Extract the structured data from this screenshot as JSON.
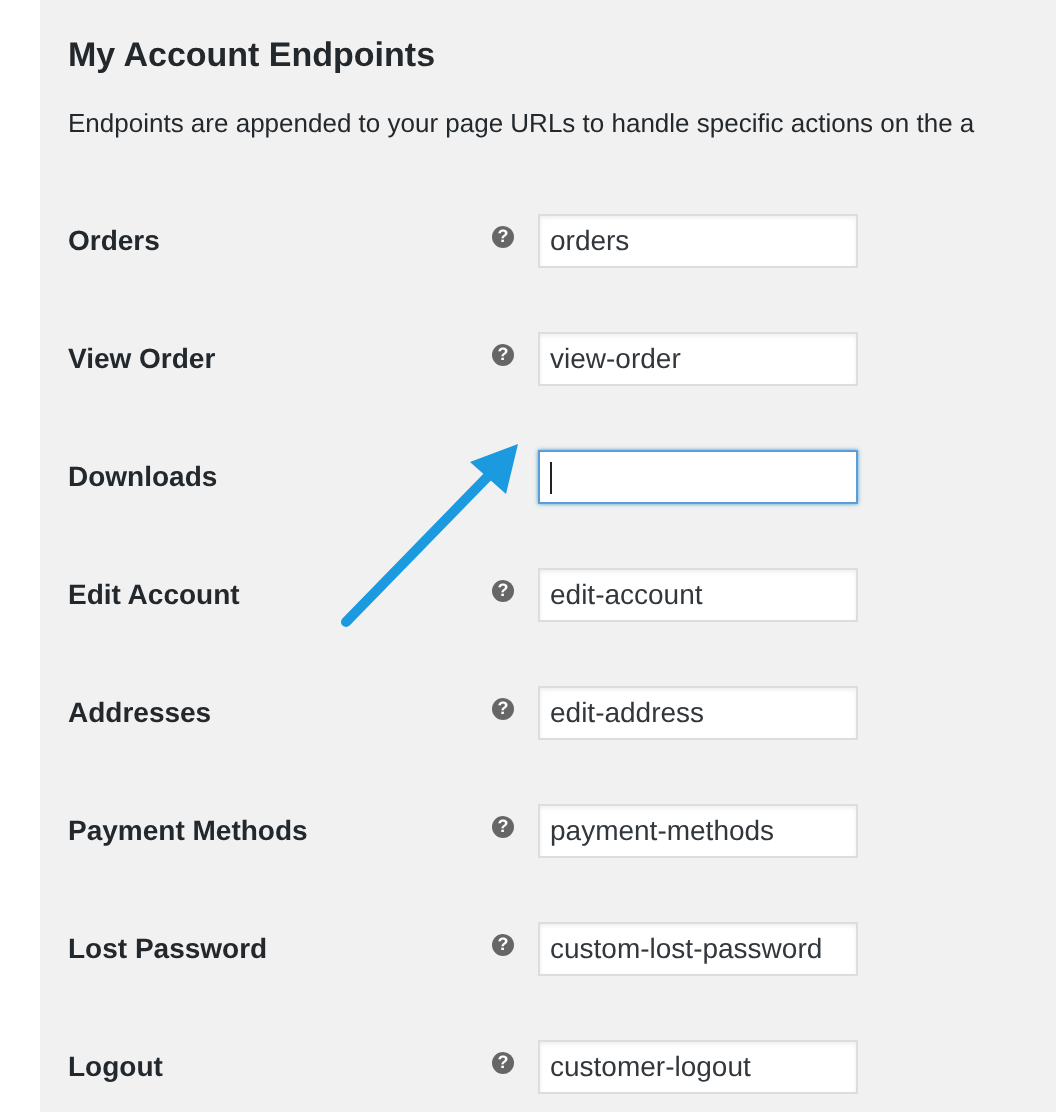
{
  "section": {
    "title": "My Account Endpoints",
    "description": "Endpoints are appended to your page URLs to handle specific actions on the a"
  },
  "fields": [
    {
      "label": "Orders",
      "help": "?",
      "value": "orders",
      "focused": false
    },
    {
      "label": "View Order",
      "help": "?",
      "value": "view-order",
      "focused": false
    },
    {
      "label": "Downloads",
      "focused": true
    },
    {
      "label": "Edit Account",
      "help": "?",
      "value": "edit-account",
      "focused": false
    },
    {
      "label": "Addresses",
      "help": "?",
      "value": "edit-address",
      "focused": false
    },
    {
      "label": "Payment Methods",
      "help": "?",
      "value": "payment-methods",
      "focused": false
    },
    {
      "label": "Lost Password",
      "help": "?",
      "value": "custom-lost-password",
      "focused": false
    },
    {
      "label": "Logout",
      "help": "?",
      "value": "customer-logout",
      "focused": false
    }
  ]
}
